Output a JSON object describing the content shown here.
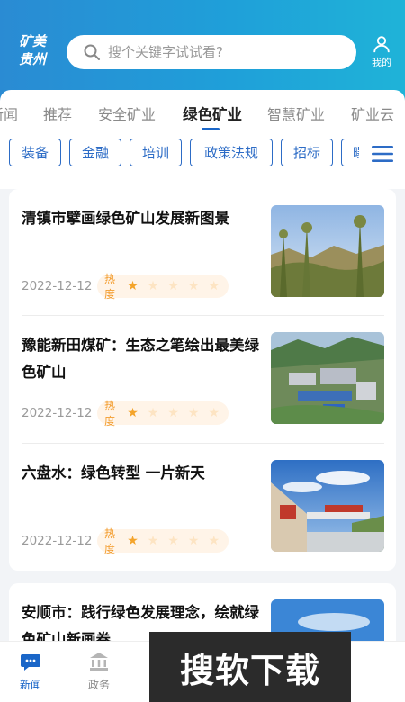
{
  "header": {
    "logo_line1": "矿美",
    "logo_line2": "贵州",
    "search_placeholder": "搜个关键字试试看?",
    "profile_label": "我的"
  },
  "tabs": [
    {
      "label": "新闻"
    },
    {
      "label": "推荐"
    },
    {
      "label": "安全矿业"
    },
    {
      "label": "绿色矿业",
      "active": true
    },
    {
      "label": "智慧矿业"
    },
    {
      "label": "矿业云"
    }
  ],
  "chips": [
    {
      "label": "装备"
    },
    {
      "label": "金融"
    },
    {
      "label": "培训"
    },
    {
      "label": "政策法规"
    },
    {
      "label": "招标"
    },
    {
      "label": "曝光"
    }
  ],
  "articles": [
    {
      "title": "清镇市擘画绿色矿山发展新图景",
      "date": "2022-12-12",
      "heat_label": "热度",
      "stars": 1
    },
    {
      "title": "豫能新田煤矿：生态之笔绘出最美绿色矿山",
      "date": "2022-12-12",
      "heat_label": "热度",
      "stars": 1
    },
    {
      "title": "六盘水：绿色转型 一片新天",
      "date": "2022-12-12",
      "heat_label": "热度",
      "stars": 1
    }
  ],
  "partial_article": {
    "title": "安顺市：践行绿色发展理念，绘就绿色矿山新画卷"
  },
  "tabbar": [
    {
      "label": "新闻",
      "active": true
    },
    {
      "label": "政务",
      "active": false
    }
  ],
  "watermark": "搜软下载",
  "colors": {
    "accent": "#1a66c8",
    "header_start": "#2a8bd3",
    "header_end": "#1fb3d8",
    "star": "#f4a42b"
  }
}
